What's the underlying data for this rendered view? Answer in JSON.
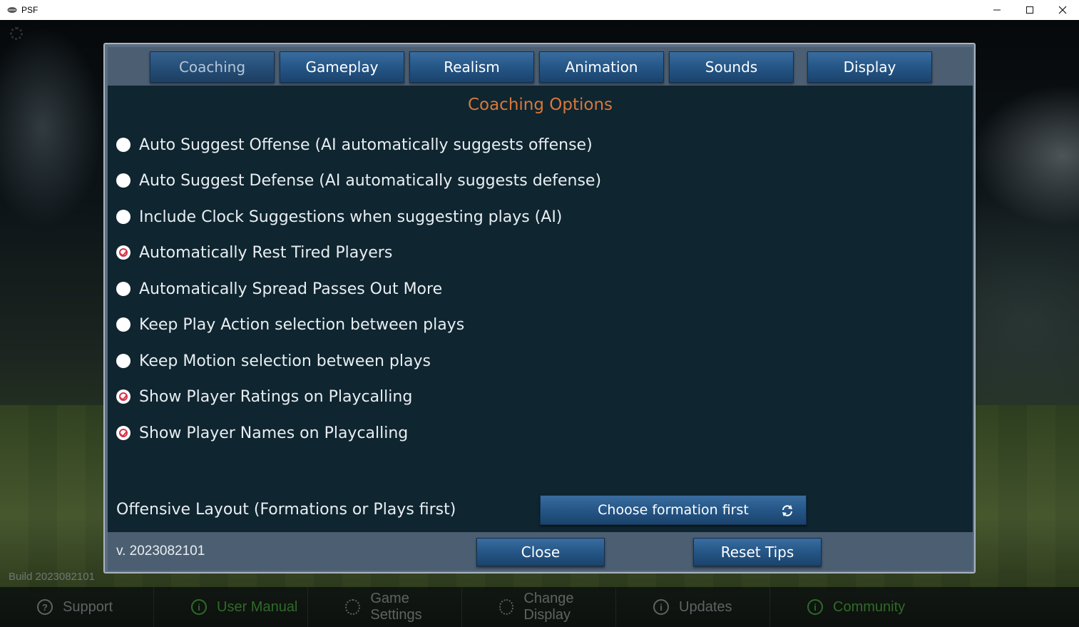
{
  "window": {
    "title": "PSF",
    "icons": {
      "app": "psf-logo-icon",
      "minimize": "minimize-icon",
      "maximize": "maximize-icon",
      "close": "close-icon"
    }
  },
  "background": {
    "build_label": "Build 2023082101",
    "nav": [
      {
        "label": "Support",
        "icon": "question-icon"
      },
      {
        "label": "User Manual",
        "icon": "info-icon"
      },
      {
        "label": "Game Settings",
        "icon": "gear-icon"
      },
      {
        "label": "Change Display",
        "icon": "gear-icon"
      },
      {
        "label": "Updates",
        "icon": "info-icon"
      },
      {
        "label": "Community",
        "icon": "info-icon"
      }
    ]
  },
  "dialog": {
    "tabs": [
      {
        "label": "Coaching",
        "active": true
      },
      {
        "label": "Gameplay",
        "active": false
      },
      {
        "label": "Realism",
        "active": false
      },
      {
        "label": "Animation",
        "active": false
      },
      {
        "label": "Sounds",
        "active": false
      },
      {
        "label": "Display",
        "active": false
      }
    ],
    "section_title": "Coaching Options",
    "options": [
      {
        "label": "Auto Suggest Offense (AI automatically suggests offense)",
        "checked": false
      },
      {
        "label": "Auto Suggest Defense (AI automatically suggests defense)",
        "checked": false
      },
      {
        "label": "Include Clock Suggestions when suggesting plays (AI)",
        "checked": false
      },
      {
        "label": "Automatically Rest Tired Players",
        "checked": true
      },
      {
        "label": "Automatically Spread Passes Out More",
        "checked": false
      },
      {
        "label": "Keep Play Action selection between plays",
        "checked": false
      },
      {
        "label": "Keep Motion selection between plays",
        "checked": false
      },
      {
        "label": "Show Player Ratings on Playcalling",
        "checked": true
      },
      {
        "label": "Show Player Names on Playcalling",
        "checked": true
      }
    ],
    "offensive_layout": {
      "label": "Offensive Layout (Formations or Plays first)",
      "value": "Choose formation first",
      "icon": "refresh-icon"
    },
    "footer": {
      "version": "v. 2023082101",
      "close_label": "Close",
      "reset_tips_label": "Reset Tips"
    }
  },
  "colors": {
    "accent_title": "#d8783a",
    "checked_mark": "#d83246",
    "button_blue": "#265889",
    "panel_bg": "#0f2530"
  }
}
